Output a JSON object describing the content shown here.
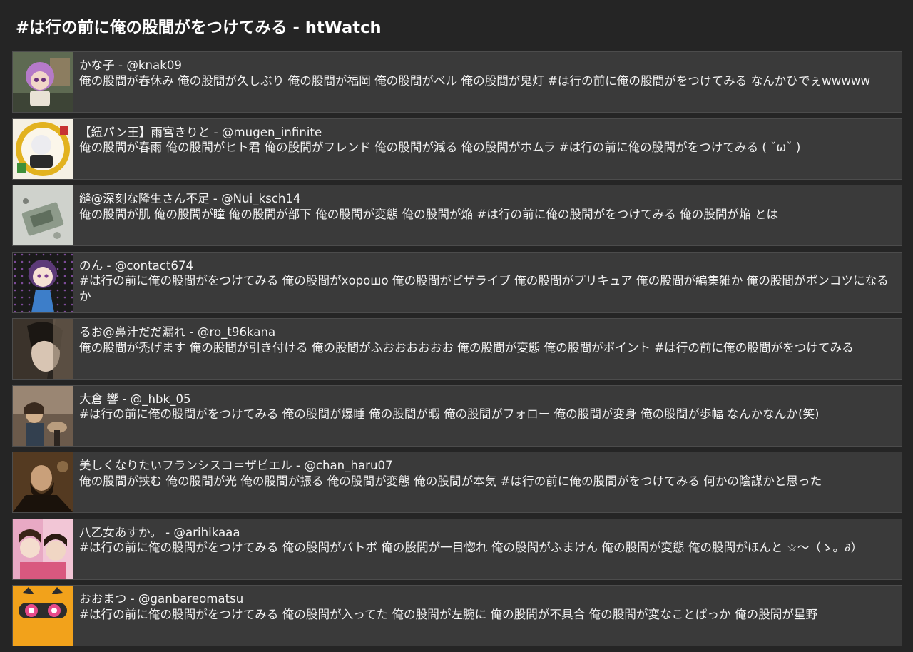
{
  "page": {
    "title": "#は行の前に俺の股間がをつけてみる - htWatch"
  },
  "tweets": [
    {
      "name": "かな子",
      "handle": "@knak09",
      "text": "俺の股間が春休み 俺の股間が久しぶり 俺の股間が福岡 俺の股間がベル 俺の股間が鬼灯 #は行の前に俺の股間がをつけてみる なんかひでぇwwwww"
    },
    {
      "name": "【紐パン王】雨宮きりと",
      "handle": "@mugen_infinite",
      "text": "俺の股間が春雨 俺の股間がヒト君 俺の股間がフレンド 俺の股間が減る 俺の股間がホムラ #は行の前に俺の股間がをつけてみる ( ˇωˇ )"
    },
    {
      "name": "縫@深刻な隆生さん不足",
      "handle": "@Nui_ksch14",
      "text": "俺の股間が肌 俺の股間が瞳 俺の股間が部下 俺の股間が変態 俺の股間が焔 #は行の前に俺の股間がをつけてみる 俺の股間が焔 とは"
    },
    {
      "name": "のん",
      "handle": "@contact674",
      "text": "#は行の前に俺の股間がをつけてみる 俺の股間がхорошо 俺の股間がピザライブ 俺の股間がプリキュア 俺の股間が編集雑か 俺の股間がポンコツになるか"
    },
    {
      "name": "るお@鼻汁だだ漏れ",
      "handle": "@ro_t96kana",
      "text": "俺の股間が禿げます 俺の股間が引き付ける 俺の股間がふおおおおおお 俺の股間が変態 俺の股間がポイント #は行の前に俺の股間がをつけてみる"
    },
    {
      "name": "大倉 響",
      "handle": "@_hbk_05",
      "text": "#は行の前に俺の股間がをつけてみる 俺の股間が爆睡 俺の股間が暇 俺の股間がフォロー 俺の股間が変身 俺の股間が歩幅 なんかなんか(笑)"
    },
    {
      "name": "美しくなりたいフランシスコ＝ザビエル",
      "handle": "@chan_haru07",
      "text": "俺の股間が挟む 俺の股間が光 俺の股間が振る 俺の股間が変態 俺の股間が本気 #は行の前に俺の股間がをつけてみる 何かの陰謀かと思った"
    },
    {
      "name": "八乙女あすか。",
      "handle": "@arihikaaa",
      "text": "#は行の前に俺の股間がをつけてみる 俺の股間がバトボ 俺の股間が一目惚れ 俺の股間がふまけん 俺の股間が変態 俺の股間がほんと ☆〜（ゝ。∂）"
    },
    {
      "name": "おおまつ",
      "handle": "@ganbareomatsu",
      "text": "#は行の前に俺の股間がをつけてみる 俺の股間が入ってた 俺の股間が左腕に 俺の股間が不具合 俺の股間が変なことばっか 俺の股間が星野"
    }
  ]
}
